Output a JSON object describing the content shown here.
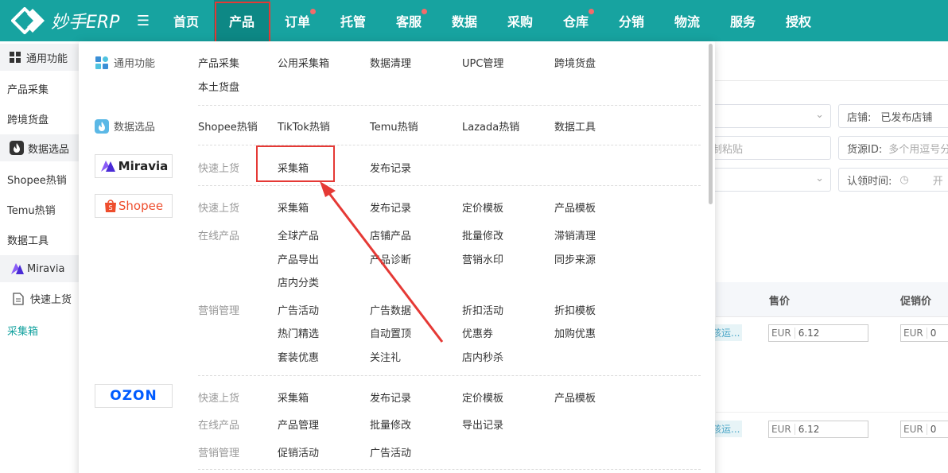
{
  "app": {
    "logo_text": "妙手ERP"
  },
  "nav": {
    "items": [
      {
        "label": "首页",
        "dot": false,
        "active": false
      },
      {
        "label": "产品",
        "dot": false,
        "active": true
      },
      {
        "label": "订单",
        "dot": true,
        "active": false
      },
      {
        "label": "托管",
        "dot": false,
        "active": false
      },
      {
        "label": "客服",
        "dot": true,
        "active": false
      },
      {
        "label": "数据",
        "dot": false,
        "active": false
      },
      {
        "label": "采购",
        "dot": false,
        "active": false
      },
      {
        "label": "仓库",
        "dot": true,
        "active": false
      },
      {
        "label": "分销",
        "dot": false,
        "active": false
      },
      {
        "label": "物流",
        "dot": false,
        "active": false
      },
      {
        "label": "服务",
        "dot": false,
        "active": false
      },
      {
        "label": "授权",
        "dot": false,
        "active": false
      }
    ]
  },
  "sidebar": {
    "group_general": "通用功能",
    "item_collect": "产品采集",
    "item_crossborder": "跨境货盘",
    "group_data": "数据选品",
    "item_shopee_hot": "Shopee热销",
    "item_temu_hot": "Temu热销",
    "item_data_tools": "数据工具",
    "group_miravia": "Miravia",
    "item_quick_upload": "快速上货",
    "item_collect_box": "采集箱"
  },
  "background": {
    "store_label": "店铺:",
    "store_value": "已发布店铺",
    "paste_hint": "制粘贴",
    "source_id_label": "货源ID:",
    "source_id_placeholder": "多个用逗号分",
    "claim_time_label": "认领时间:",
    "claim_time_start": "开",
    "col_price": "售价",
    "col_promo_price": "促销价",
    "rows": [
      {
        "tag": "孩运...",
        "currency": "EUR",
        "price": "6.12",
        "promo_currency": "EUR",
        "promo": "0"
      },
      {
        "tag": "孩运...",
        "currency": "EUR",
        "price": "6.12",
        "promo_currency": "EUR",
        "promo": "0"
      }
    ]
  },
  "dropdown": {
    "general": {
      "title": "通用功能",
      "links": [
        "产品采集",
        "公用采集箱",
        "数据清理",
        "UPC管理",
        "跨境货盘",
        "本土货盘"
      ]
    },
    "data_select": {
      "title": "数据选品",
      "links": [
        "Shopee热销",
        "TikTok热销",
        "Temu热销",
        "Lazada热销",
        "数据工具"
      ]
    },
    "miravia": {
      "brand": "Miravia",
      "section_label": "快速上货",
      "links": [
        "采集箱",
        "发布记录"
      ]
    },
    "shopee": {
      "brand": "Shopee",
      "quick_label": "快速上货",
      "quick_links": [
        "采集箱",
        "发布记录",
        "定价模板",
        "产品模板"
      ],
      "online_label": "在线产品",
      "online_links": [
        "全球产品",
        "店铺产品",
        "批量修改",
        "滞销清理",
        "产品导出",
        "产品诊断",
        "营销水印",
        "同步来源",
        "店内分类"
      ],
      "marketing_label": "营销管理",
      "marketing_links": [
        "广告活动",
        "广告数据",
        "折扣活动",
        "折扣模板",
        "热门精选",
        "自动置顶",
        "优惠券",
        "加购优惠",
        "套装优惠",
        "关注礼",
        "店内秒杀"
      ]
    },
    "ozon": {
      "brand": "OZON",
      "quick_label": "快速上货",
      "quick_links": [
        "采集箱",
        "发布记录",
        "定价模板",
        "产品模板"
      ],
      "online_label": "在线产品",
      "online_links": [
        "产品管理",
        "批量修改",
        "导出记录"
      ],
      "marketing_label": "营销管理",
      "marketing_links": [
        "促销活动",
        "广告活动"
      ]
    }
  },
  "colors": {
    "brand_teal": "#17a3a0",
    "highlight_red": "#e53935",
    "shopee_orange": "#ee4d2d",
    "ozon_blue": "#005bff",
    "miravia_purple": "#6b3df5"
  }
}
